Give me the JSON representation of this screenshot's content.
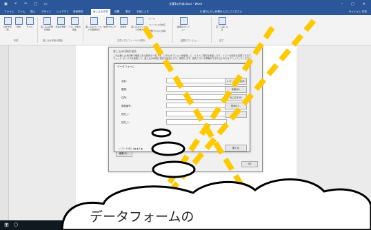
{
  "titlebar": {
    "document": "文書1の作成.docx - Word"
  },
  "tabs": [
    "ファイル",
    "ホーム",
    "挿入",
    "デザイン",
    "レイアウト",
    "参考資料",
    "差し込み文書",
    "校閲",
    "表示",
    "お気に入り"
  ],
  "active_tab": "差し込み文書",
  "tell_me": "実行したい作業を入力してください",
  "user": "サインイン  共有",
  "ribbon": {
    "buttons": [
      "はがき印刷",
      "封筒",
      "ラベル",
      "差し込み印刷の開始",
      "宛先の選択",
      "アドレス帳の編集",
      "差し込みフィールドの強調表示",
      "住所ブロック",
      "挨拶文",
      "差し込みフィールドの挿入",
      "ルール",
      "フィールドの対応",
      "複数ラベルに反映",
      "結果のプレビュー",
      "完了と差し込み"
    ],
    "groups": [
      "作成",
      "差し込み印刷の開始",
      "文章入力とフィールドの挿入",
      "結果のプレビュー",
      "完了"
    ]
  },
  "outer_dialog": {
    "title": "差し込み印刷の宛先",
    "text": "これは差し込み印刷で使用される宛先の一覧です。以下のオプションを使用して、リストに宛先を追加したり、リストの宛先を変更できます。チェック ボックスを使用して、差し込み印刷に宛先を追加したり、削除します。宛先リストの準備ができたら [OK] をクリックしてください。",
    "ok": "OK",
    "edit": "編集(E)..."
  },
  "data_form": {
    "title": "データフォーム",
    "fields": [
      "名前:",
      "郵便:",
      "住所:",
      "郵便番号:",
      "宛先_1:",
      "宛先_2:"
    ],
    "buttons": [
      "レコードの追加(A)",
      "削除(D)",
      "元に戻す(R)",
      "検索(E)...",
      ""
    ],
    "close": "閉じる",
    "record_label": "レコード(R):",
    "record_num": "1"
  },
  "caption": "データフォームの",
  "status": "1/1 ページ  0 文字  日本語"
}
